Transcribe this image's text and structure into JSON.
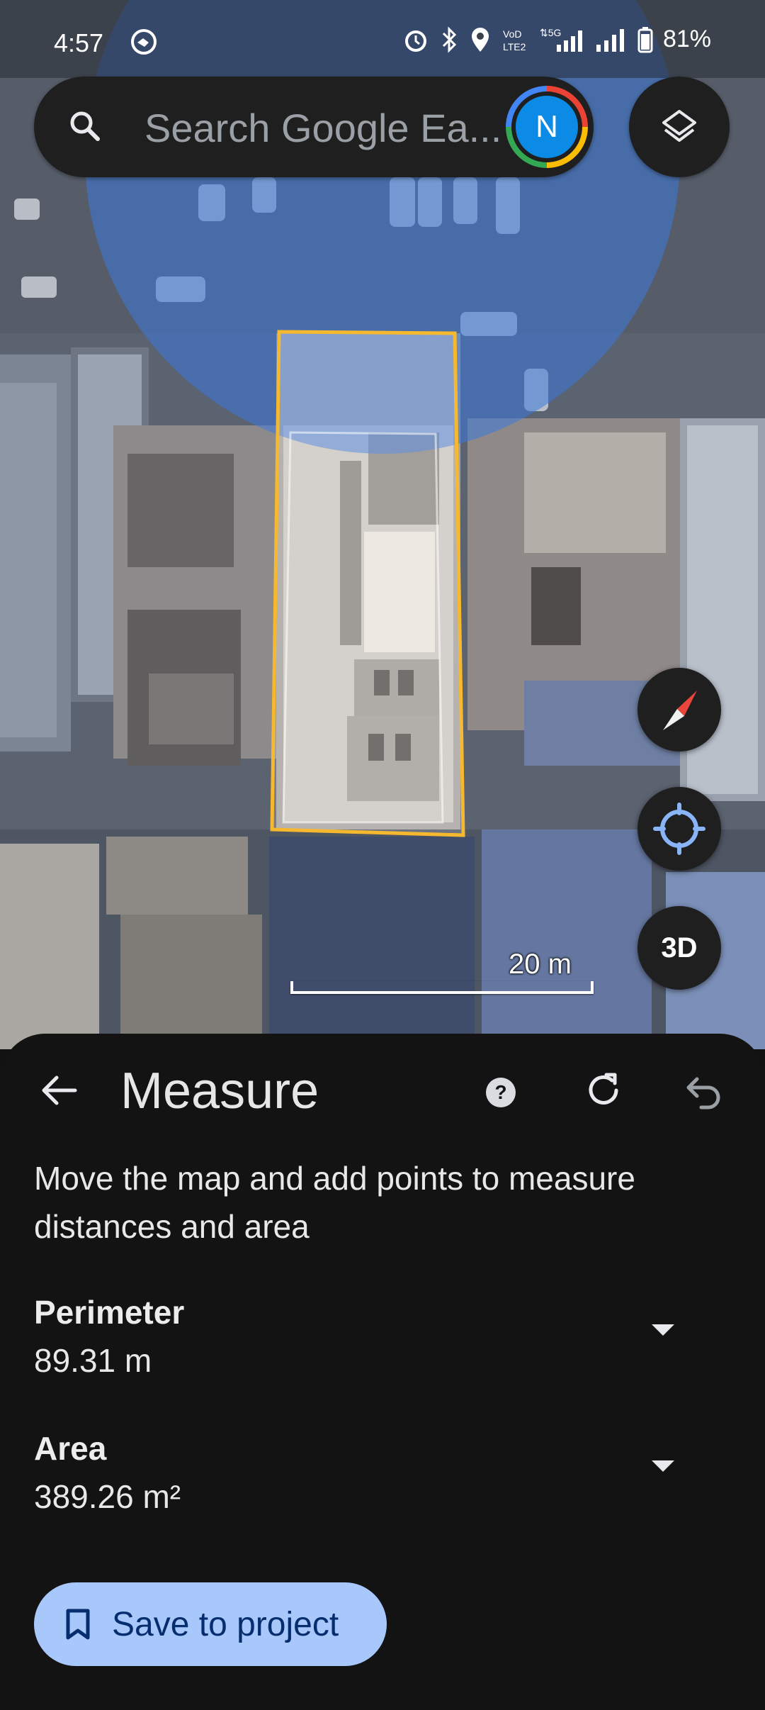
{
  "status_bar": {
    "time": "4:57",
    "battery": "81%",
    "icons": [
      "app-notification-icon",
      "alarm-icon",
      "bluetooth-icon",
      "location-icon",
      "volte-icon",
      "5g-signal-icon",
      "signal-icon",
      "battery-icon"
    ]
  },
  "search": {
    "placeholder": "Search Google Ea...",
    "avatar_letter": "N"
  },
  "map": {
    "scale_label": "20 m",
    "three_d_label": "3D",
    "measure_outline_color": "#f5b82e",
    "overlay_color": "#3c78dc"
  },
  "sheet": {
    "title": "Measure",
    "description": "Move the map and add points to measure distances and area",
    "perimeter": {
      "label": "Perimeter",
      "value": "89.31 m"
    },
    "area": {
      "label": "Area",
      "value": "389.26 m²"
    },
    "save_label": "Save to project"
  }
}
